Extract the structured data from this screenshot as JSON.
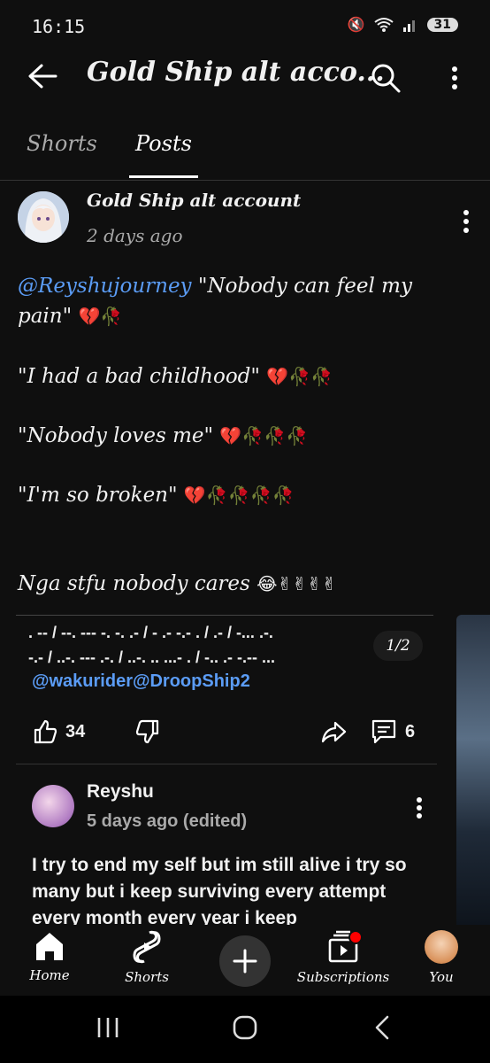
{
  "status": {
    "time": "16:15",
    "battery": "31"
  },
  "header": {
    "title": "Gold Ship alt acco..."
  },
  "tabs": [
    {
      "label": "Shorts"
    },
    {
      "label": "Posts"
    }
  ],
  "post": {
    "author": "Gold Ship alt account",
    "time": "2 days ago",
    "mention": "@Reyshujourney",
    "line1_rest": " \"Nobody can feel my",
    "line2": "pain\"",
    "line3": "\"I had a bad childhood\"",
    "line4": "\"Nobody loves me\"",
    "line5": "\"I'm so broken\"",
    "line6": "Nga stfu nobody cares",
    "emoji": {
      "l2": "💔🥀",
      "l3": "💔🥀🥀",
      "l4": "💔🥀🥀🥀",
      "l5": "💔🥀🥀🥀🥀",
      "l6": "😂✌✌✌✌"
    },
    "quoted": {
      "line1": ". -- / --. --- -. -. .- / - .- -.- . / .- / -... .-.",
      "line2": "-.- / ..-. --- .-. / ..-. .. ...- . / -.. .- -.-- ...",
      "mention": "@wakurider@DroopShip2",
      "page_indicator": "1/2"
    },
    "likes": "34",
    "comments": "6"
  },
  "comment": {
    "author": "Reyshu",
    "time": "5 days ago (edited)",
    "text": "I try to end my self but im still alive i try so many but i keep surviving every attempt every month every year i keep"
  },
  "bottom_nav": [
    {
      "label": "Home"
    },
    {
      "label": "Shorts"
    },
    {
      "label": "Subscriptions"
    },
    {
      "label": "You"
    }
  ],
  "colors": {
    "background": "#0f0f0f",
    "mention": "#5b9cf5",
    "notification": "#ff0000"
  },
  "icons": [
    "back-arrow-icon",
    "search-icon",
    "more-vert-icon",
    "like-icon",
    "dislike-icon",
    "share-icon",
    "comment-icon",
    "home-icon",
    "shorts-icon",
    "plus-icon",
    "subscriptions-icon"
  ]
}
